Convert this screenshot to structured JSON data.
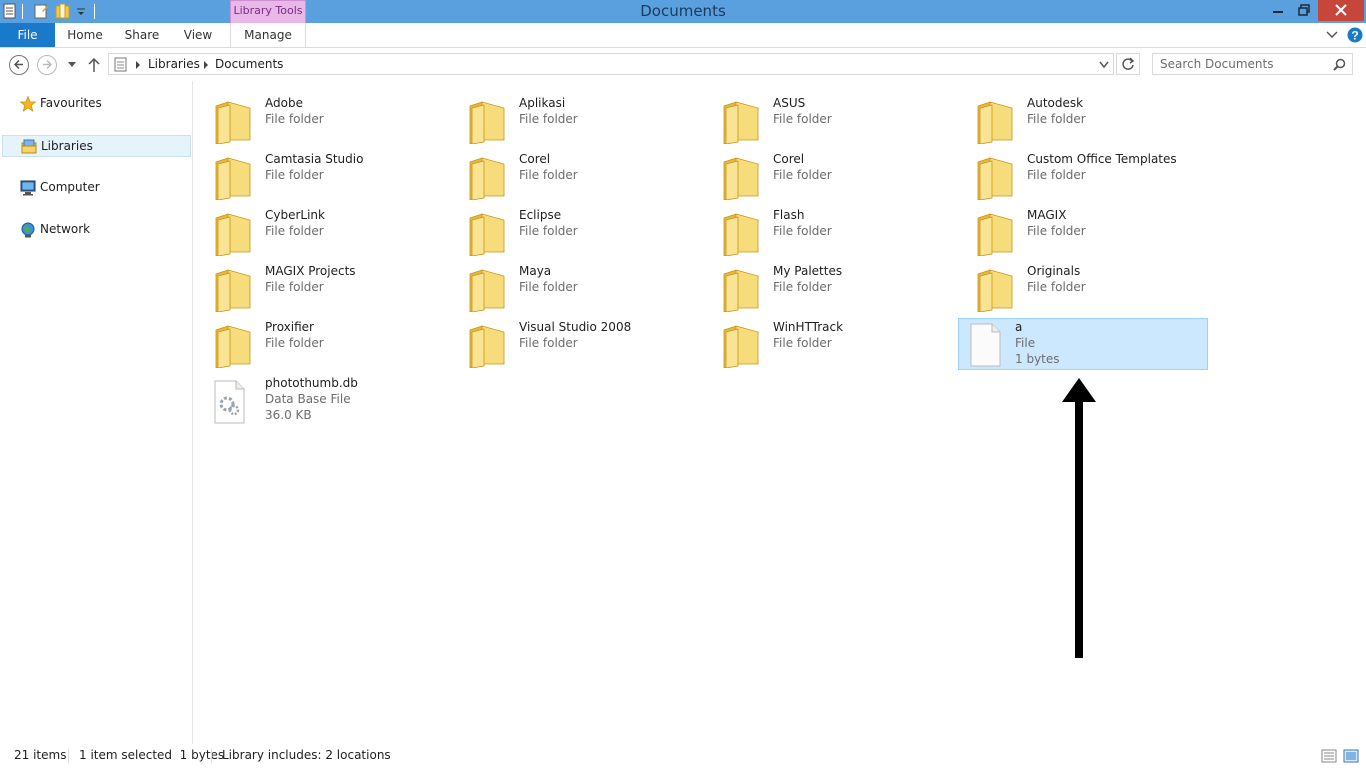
{
  "window": {
    "title": "Documents",
    "contextual_tab": "Library Tools"
  },
  "ribbon": {
    "tabs": [
      {
        "label": "File"
      },
      {
        "label": "Home"
      },
      {
        "label": "Share"
      },
      {
        "label": "View"
      },
      {
        "label": "Manage"
      }
    ]
  },
  "address": {
    "crumbs": [
      "Libraries",
      "Documents"
    ]
  },
  "search": {
    "placeholder": "Search Documents"
  },
  "nav": {
    "items": [
      {
        "label": "Favourites",
        "icon": "star-icon",
        "selected": false
      },
      {
        "label": "Libraries",
        "icon": "libraries-icon",
        "selected": true
      },
      {
        "label": "Computer",
        "icon": "computer-icon",
        "selected": false
      },
      {
        "label": "Network",
        "icon": "network-icon",
        "selected": false
      }
    ]
  },
  "items": [
    {
      "name": "Adobe",
      "type": "File folder",
      "icon": "folder-icon"
    },
    {
      "name": "Aplikasi",
      "type": "File folder",
      "icon": "folder-icon"
    },
    {
      "name": "ASUS",
      "type": "File folder",
      "icon": "folder-icon"
    },
    {
      "name": "Autodesk",
      "type": "File folder",
      "icon": "folder-icon"
    },
    {
      "name": "Camtasia Studio",
      "type": "File folder",
      "icon": "folder-icon"
    },
    {
      "name": "Corel",
      "type": "File folder",
      "icon": "folder-icon"
    },
    {
      "name": "Corel",
      "type": "File folder",
      "icon": "folder-icon"
    },
    {
      "name": "Custom Office Templates",
      "type": "File folder",
      "icon": "folder-icon"
    },
    {
      "name": "CyberLink",
      "type": "File folder",
      "icon": "folder-icon"
    },
    {
      "name": "Eclipse",
      "type": "File folder",
      "icon": "folder-icon"
    },
    {
      "name": "Flash",
      "type": "File folder",
      "icon": "folder-icon"
    },
    {
      "name": "MAGIX",
      "type": "File folder",
      "icon": "folder-icon"
    },
    {
      "name": "MAGIX Projects",
      "type": "File folder",
      "icon": "folder-icon"
    },
    {
      "name": "Maya",
      "type": "File folder",
      "icon": "folder-icon"
    },
    {
      "name": "My Palettes",
      "type": "File folder",
      "icon": "folder-icon"
    },
    {
      "name": "Originals",
      "type": "File folder",
      "icon": "folder-icon"
    },
    {
      "name": "Proxifier",
      "type": "File folder",
      "icon": "folder-icon"
    },
    {
      "name": "Visual Studio 2008",
      "type": "File folder",
      "icon": "folder-icon"
    },
    {
      "name": "WinHTTrack",
      "type": "File folder",
      "icon": "folder-icon"
    },
    {
      "name": "a",
      "type": "File",
      "size": "1 bytes",
      "icon": "file-icon",
      "selected": true
    },
    {
      "name": "photothumb.db",
      "type": "Data Base File",
      "size": "36.0 KB",
      "icon": "database-file-icon"
    }
  ],
  "status": {
    "count": "21 items",
    "selection": "1 item selected  1 bytes",
    "library": "Library includes: 2 locations"
  },
  "colors": {
    "titlebar": "#5aa0de",
    "file_tab": "#1979ca",
    "selection": "#cce8ff",
    "close_button": "#c7463b"
  }
}
